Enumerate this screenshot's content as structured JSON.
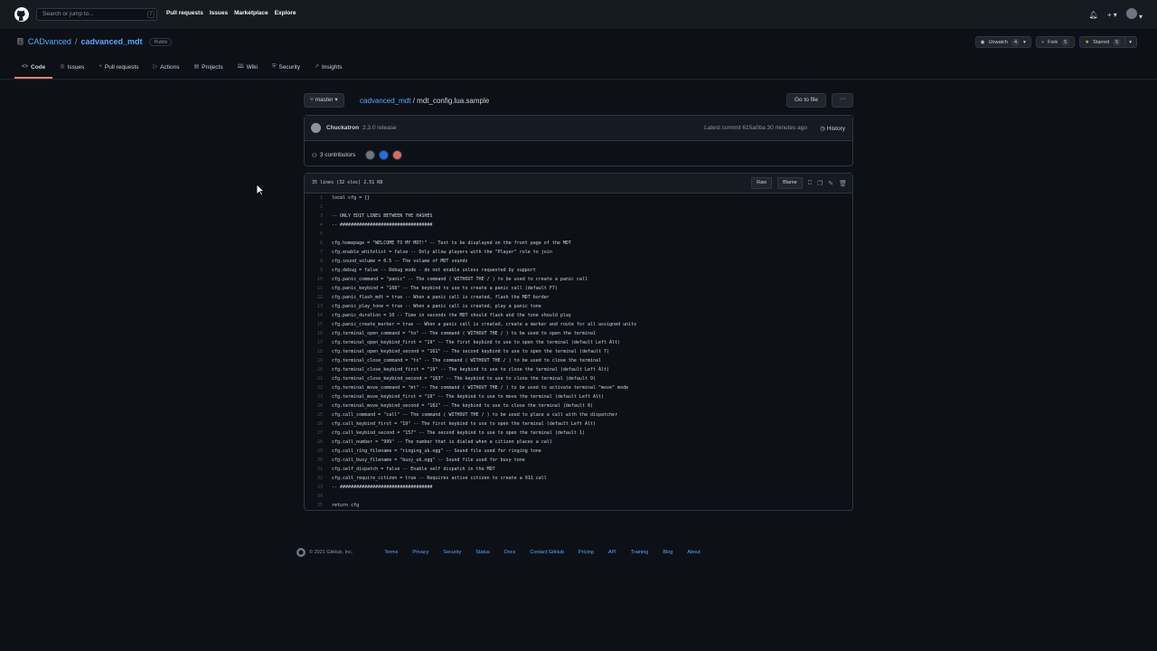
{
  "header": {
    "search_placeholder": "Search or jump to...",
    "search_hint": "/",
    "nav": [
      "Pull requests",
      "Issues",
      "Marketplace",
      "Explore"
    ]
  },
  "repo": {
    "owner": "CADvanced",
    "name": "cadvanced_mdt",
    "visibility": "Public",
    "watch": {
      "label": "Unwatch",
      "count": "4"
    },
    "fork": {
      "label": "Fork",
      "count": "5"
    },
    "star": {
      "label": "Starred",
      "count": "5"
    },
    "tabs": [
      {
        "label": "Code",
        "icon": "code-icon"
      },
      {
        "label": "Issues",
        "icon": "issue-icon"
      },
      {
        "label": "Pull requests",
        "icon": "pr-icon"
      },
      {
        "label": "Actions",
        "icon": "play-icon"
      },
      {
        "label": "Projects",
        "icon": "project-icon"
      },
      {
        "label": "Wiki",
        "icon": "book-icon"
      },
      {
        "label": "Security",
        "icon": "shield-icon"
      },
      {
        "label": "Insights",
        "icon": "graph-icon"
      }
    ]
  },
  "file_nav": {
    "branch": "master",
    "repo_link": "cadvanced_mdt",
    "file_name": "mdt_config.lua.sample",
    "goto": "Go to file",
    "more": "···"
  },
  "commit": {
    "author": "Chuckatron",
    "message": "2.3.0 release",
    "meta": "Latest commit 615a0ba 30 minutes ago",
    "history": "History",
    "contributors": "3 contributors"
  },
  "file": {
    "info": "35 lines (32 sloc)   2.51 KB",
    "raw": "Raw",
    "blame": "Blame",
    "lines": [
      "local cfg = {}",
      "",
      "-- ONLY EDIT LINES BETWEEN THE HASHES",
      "-- ##################################",
      "",
      "cfg.homepage = \"WELCOME TO MY MDT!\" -- Text to be displayed on the front page of the MDT",
      "cfg.enable_whitelist = false -- Only allow players with the \"Player\" role to join",
      "cfg.sound_volume = 0.5 -- The volume of MDT sounds",
      "cfg.debug = false -- Debug mode - do not enable unless requested by support",
      "cfg.panic_command = \"panic\" -- The command ( WITHOUT THE / ) to be used to create a panic call",
      "cfg.panic_keybind = \"168\" -- The keybind to use to create a panic call (default F7)",
      "cfg.panic_flash_mdt = true -- When a panic call is created, flash the MDT border",
      "cfg.panic_play_tone = true -- When a panic call is created, play a panic tone",
      "cfg.panic_duration = 10 -- Time in seconds the MDT should flash and the tone should play",
      "cfg.panic_create_marker = true -- When a panic call is created, create a marker and route for all assigned units",
      "cfg.terminal_open_command = \"to\" -- The command ( WITHOUT THE / ) to be used to open the terminal",
      "cfg.terminal_open_keybind_first = \"19\" -- The first keybind to use to open the terminal (default Left Alt)",
      "cfg.terminal_open_keybind_second = \"161\" -- The second keybind to use to open the terminal (default 7)",
      "cfg.terminal_close_command = \"tc\" -- The command ( WITHOUT THE / ) to be used to close the terminal",
      "cfg.terminal_close_keybind_first = \"19\" -- The keybind to use to close the terminal (default Left Alt)",
      "cfg.terminal_close_keybind_second = \"163\" -- The keybind to use to close the terminal (default 9)",
      "cfg.terminal_move_command = \"mt\" -- The command ( WITHOUT THE / ) to be used to activate terminal \"move\" mode",
      "cfg.terminal_move_keybind_first = \"19\" -- The keybind to use to move the terminal (default Left Alt)",
      "cfg.terminal_move_keybind_second = \"162\" -- The keybind to use to close the terminal (default 8)",
      "cfg.call_command = \"call\" -- The command ( WITHOUT THE / ) to be used to place a call with the dispatcher",
      "cfg.call_keybind_first = \"19\" -- The first keybind to use to open the terminal (default Left Alt)",
      "cfg.call_keybind_second = \"157\" -- The second keybind to use to open the terminal (default 1)",
      "cfg.call_number = \"999\" -- The number that is dialed when a citizen places a call",
      "cfg.call_ring_filename = \"ringing_uk.ogg\" -- Sound file used for ringing tone",
      "cfg.call_busy_filename = \"busy_uk.ogg\" -- Sound file used for busy tone",
      "cfg.self_dispatch = false -- Enable self dispatch in the MDT",
      "cfg.call_require_citizen = true -- Requires active citizen to create a 911 call",
      "-- ##################################",
      "",
      "return cfg"
    ]
  },
  "footer": {
    "copyright": "© 2021 GitHub, Inc.",
    "links": [
      "Terms",
      "Privacy",
      "Security",
      "Status",
      "Docs",
      "Contact GitHub",
      "Pricing",
      "API",
      "Training",
      "Blog",
      "About"
    ]
  }
}
